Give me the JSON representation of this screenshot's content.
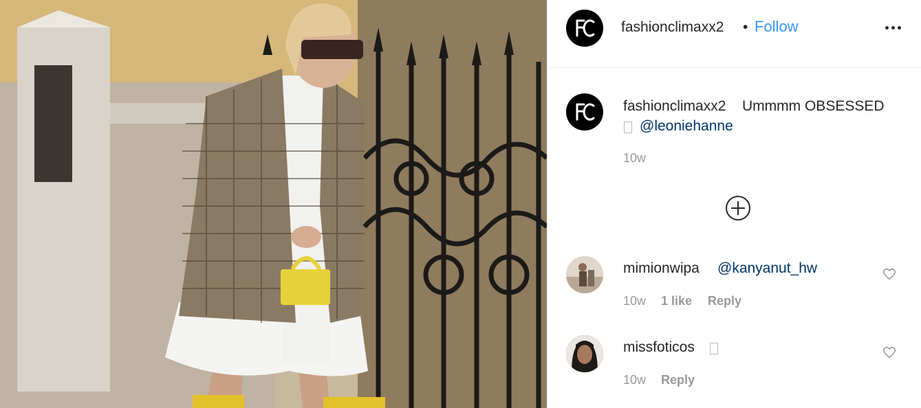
{
  "post": {
    "photo_alt": "",
    "author": "fashionclimaxx2",
    "separator": "•",
    "follow_label": "Follow",
    "more_icon": "more-options-icon"
  },
  "caption": {
    "username": "fashionclimaxx2",
    "text": "Ummmm OBSESSED",
    "emoji_placeholder": "",
    "mention": "@leoniehanne",
    "time": "10w"
  },
  "load_more_icon": "plus-circle-icon",
  "comments": [
    {
      "username": "mimionwipa",
      "mention": "@kanyanut_hw",
      "time": "10w",
      "likes": "1 like",
      "reply": "Reply"
    },
    {
      "username": "missfoticos",
      "time": "10w",
      "reply": "Reply"
    }
  ],
  "colors": {
    "link": "#003569",
    "follow": "#3897f0",
    "meta": "#999999",
    "text": "#262626"
  }
}
